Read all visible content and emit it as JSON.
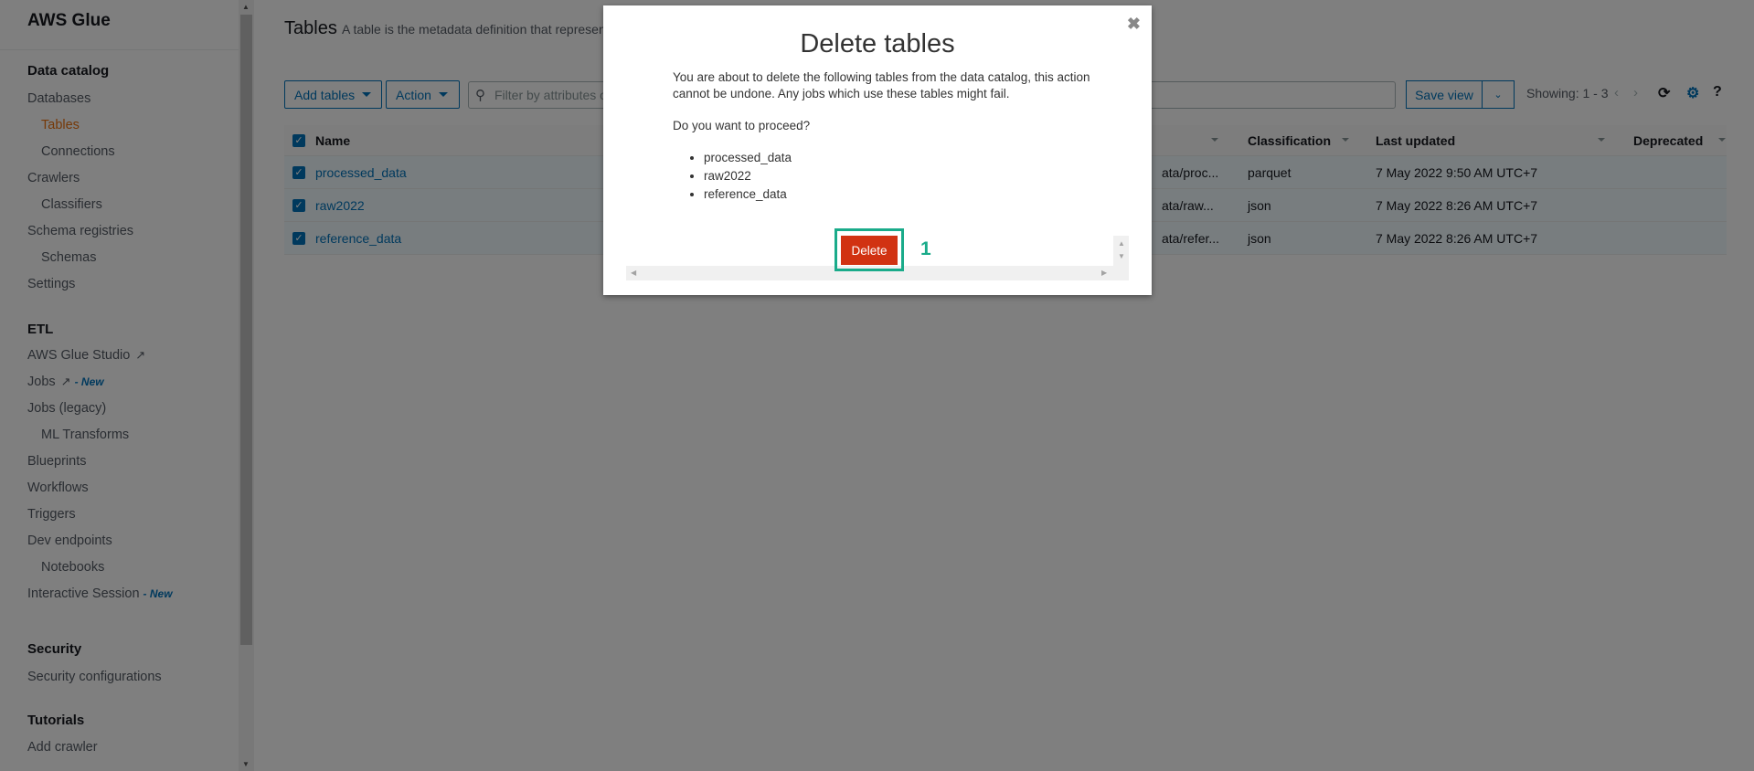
{
  "sidebar": {
    "title": "AWS Glue",
    "sections": {
      "data_catalog": "Data catalog",
      "etl": "ETL",
      "security": "Security",
      "tutorials": "Tutorials"
    },
    "items": {
      "databases": "Databases",
      "tables": "Tables",
      "connections": "Connections",
      "crawlers": "Crawlers",
      "classifiers": "Classifiers",
      "schema_registries": "Schema registries",
      "schemas": "Schemas",
      "settings": "Settings",
      "glue_studio": "AWS Glue Studio",
      "jobs": "Jobs",
      "jobs_new": "- New",
      "jobs_legacy": "Jobs (legacy)",
      "ml_transforms": "ML Transforms",
      "blueprints": "Blueprints",
      "workflows": "Workflows",
      "triggers": "Triggers",
      "dev_endpoints": "Dev endpoints",
      "notebooks": "Notebooks",
      "interactive_session": "Interactive Session",
      "interactive_new": "- New",
      "security_configurations": "Security configurations",
      "add_crawler": "Add crawler"
    }
  },
  "header": {
    "title": "Tables",
    "description": "A table is the metadata definition that represen"
  },
  "toolbar": {
    "add_tables": "Add tables",
    "action": "Action",
    "search_placeholder": "Filter by attributes or",
    "save_view": "Save view",
    "showing": "Showing: 1 - 3"
  },
  "table": {
    "columns": {
      "name": "Name",
      "classification": "Classification",
      "last_updated": "Last updated",
      "deprecated": "Deprecated"
    },
    "rows": [
      {
        "name": "processed_data",
        "location": "ata/proc...",
        "classification": "parquet",
        "last_updated": "7 May 2022 9:50 AM UTC+7",
        "deprecated": ""
      },
      {
        "name": "raw2022",
        "location": "ata/raw...",
        "classification": "json",
        "last_updated": "7 May 2022 8:26 AM UTC+7",
        "deprecated": ""
      },
      {
        "name": "reference_data",
        "location": "ata/refer...",
        "classification": "json",
        "last_updated": "7 May 2022 8:26 AM UTC+7",
        "deprecated": ""
      }
    ]
  },
  "modal": {
    "title": "Delete tables",
    "message": "You are about to delete the following tables from the data catalog, this action cannot be undone. Any jobs which use these tables might fail.",
    "question": "Do you want to proceed?",
    "tables": [
      "processed_data",
      "raw2022",
      "reference_data"
    ],
    "delete_label": "Delete",
    "annotation": "1"
  },
  "colors": {
    "accent": "#0073bb",
    "active_nav": "#ec7211",
    "danger": "#d13212",
    "annotation": "#1aab8a"
  }
}
